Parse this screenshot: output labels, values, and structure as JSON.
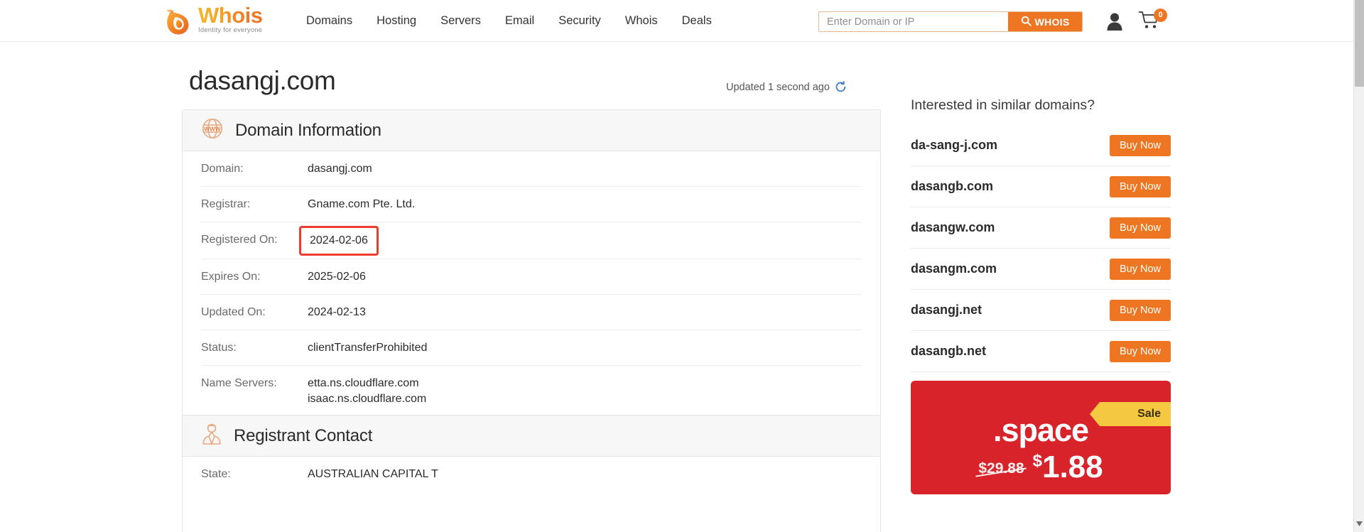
{
  "brand": {
    "logo_word": "Whois",
    "logo_tagline": "Identity for everyone",
    "accent_color": "#ee7623",
    "promo_color": "#d8232a",
    "highlight_color": "#ee3b2f"
  },
  "header": {
    "nav": [
      {
        "label": "Domains",
        "name": "nav-domains"
      },
      {
        "label": "Hosting",
        "name": "nav-hosting"
      },
      {
        "label": "Servers",
        "name": "nav-servers"
      },
      {
        "label": "Email",
        "name": "nav-email"
      },
      {
        "label": "Security",
        "name": "nav-security"
      },
      {
        "label": "Whois",
        "name": "nav-whois"
      },
      {
        "label": "Deals",
        "name": "nav-deals"
      }
    ],
    "search": {
      "placeholder": "Enter Domain or IP",
      "value": "",
      "button_label": "WHOIS",
      "button_icon": "search-icon"
    },
    "account_icon": "user-icon",
    "cart_icon": "shopping-cart-icon",
    "cart_count": "0"
  },
  "main": {
    "page_title": "dasangj.com",
    "updated_text": "Updated 1 second ago",
    "refresh_icon": "refresh-icon",
    "sections": [
      {
        "title": "Domain Information",
        "icon": "www-globe-icon",
        "rows": [
          {
            "key": "Domain:",
            "value": "dasangj.com",
            "highlighted": false
          },
          {
            "key": "Registrar:",
            "value": "Gname.com Pte. Ltd.",
            "highlighted": false
          },
          {
            "key": "Registered On:",
            "value": "2024-02-06",
            "highlighted": true
          },
          {
            "key": "Expires On:",
            "value": "2025-02-06",
            "highlighted": false
          },
          {
            "key": "Updated On:",
            "value": "2024-02-13",
            "highlighted": false
          },
          {
            "key": "Status:",
            "value": "clientTransferProhibited",
            "highlighted": false
          },
          {
            "key": "Name Servers:",
            "value": "etta.ns.cloudflare.com\nisaac.ns.cloudflare.com",
            "highlighted": false
          }
        ]
      },
      {
        "title": "Registrant Contact",
        "icon": "person-contact-icon",
        "rows": [
          {
            "key": "State:",
            "value": "AUSTRALIAN CAPITAL T",
            "highlighted": false
          }
        ]
      }
    ]
  },
  "sidebar": {
    "title": "Interested in similar domains?",
    "buy_label": "Buy Now",
    "domains": [
      {
        "name": "da-sang-j.com"
      },
      {
        "name": "dasangb.com"
      },
      {
        "name": "dasangw.com"
      },
      {
        "name": "dasangm.com"
      },
      {
        "name": "dasangj.net"
      },
      {
        "name": "dasangb.net"
      }
    ],
    "promo": {
      "ribbon": "Sale",
      "tld": ".space",
      "old_price": "$29.88",
      "currency": "$",
      "new_price": "1.88"
    }
  },
  "scrollbar": {
    "down_arrow_icon": "chevron-down-icon"
  }
}
